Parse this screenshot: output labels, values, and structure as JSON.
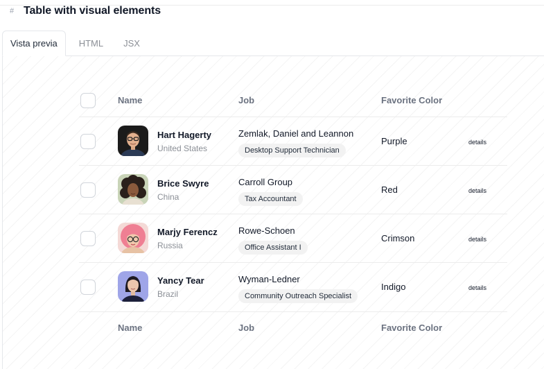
{
  "header": {
    "hash_glyph": "#",
    "title": "Table with visual elements"
  },
  "tabs": [
    {
      "label": "Vista previa",
      "active": true
    },
    {
      "label": "HTML",
      "active": false
    },
    {
      "label": "JSX",
      "active": false
    }
  ],
  "table": {
    "columns": {
      "name": "Name",
      "job": "Job",
      "favorite_color": "Favorite Color"
    },
    "details_label": "details",
    "rows": [
      {
        "name": "Hart Hagerty",
        "country": "United States",
        "company": "Zemlak, Daniel and Leannon",
        "job_title": "Desktop Support Technician",
        "favorite_color": "Purple",
        "avatar_icon": "man-with-glasses-avatar"
      },
      {
        "name": "Brice Swyre",
        "country": "China",
        "company": "Carroll Group",
        "job_title": "Tax Accountant",
        "favorite_color": "Red",
        "avatar_icon": "curly-hair-woman-avatar"
      },
      {
        "name": "Marjy Ferencz",
        "country": "Russia",
        "company": "Rowe-Schoen",
        "job_title": "Office Assistant I",
        "favorite_color": "Crimson",
        "avatar_icon": "pink-hair-woman-avatar"
      },
      {
        "name": "Yancy Tear",
        "country": "Brazil",
        "company": "Wyman-Ledner",
        "job_title": "Community Outreach Specialist",
        "favorite_color": "Indigo",
        "avatar_icon": "dark-hair-woman-avatar"
      }
    ]
  }
}
